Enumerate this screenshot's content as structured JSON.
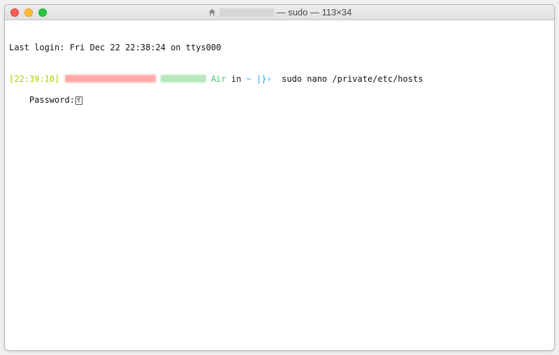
{
  "window": {
    "title_plain": " — sudo — 113×34"
  },
  "terminal": {
    "line1": "Last login: Fri Dec 22 22:38:24 on ttys000",
    "bracket_open": "[",
    "timestamp": "22:39:10",
    "bracket_close": "]",
    "air": " Air ",
    "in": "in ",
    "tilde": "~",
    "prompt": " |}› ",
    "command": " sudo nano /private/etc/hosts",
    "password_label": "Password:"
  }
}
